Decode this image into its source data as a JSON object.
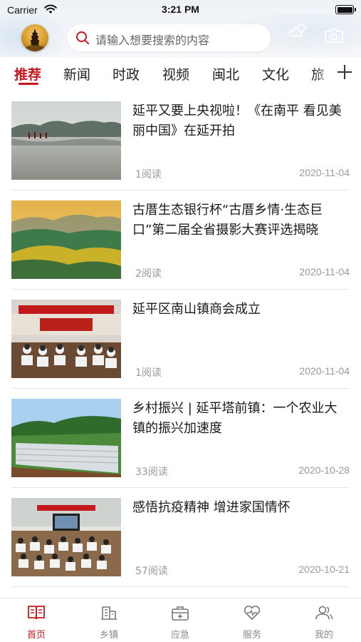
{
  "status_bar": {
    "carrier": "Carrier",
    "time": "3:21 PM"
  },
  "header": {
    "search_placeholder": "请输入想要搜索的内容",
    "weather": {
      "temperature": "26°C",
      "icon": "partly-cloudy-icon"
    },
    "camera_icon": "camera-icon"
  },
  "tabs": [
    {
      "label": "推荐",
      "active": true
    },
    {
      "label": "新闻"
    },
    {
      "label": "时政"
    },
    {
      "label": "视频"
    },
    {
      "label": "闽北"
    },
    {
      "label": "文化"
    },
    {
      "label": "旅"
    }
  ],
  "feed": [
    {
      "title": "延平又要上央视啦！《在南平 看见美丽中国》在延开拍",
      "reads": "1阅读",
      "date": "2020-11-04"
    },
    {
      "title": "古厝生态银行杯“古厝乡情·生态巨口”第二届全省摄影大赛评选揭晓",
      "reads": "2阅读",
      "date": "2020-11-04"
    },
    {
      "title": "延平区南山镇商会成立",
      "reads": "1阅读",
      "date": "2020-11-04"
    },
    {
      "title": "乡村振兴 | 延平塔前镇：一个农业大镇的振兴加速度",
      "reads": "33阅读",
      "date": "2020-10-28"
    },
    {
      "title": "感悟抗疫精神 增进家国情怀",
      "reads": "57阅读",
      "date": "2020-10-21"
    }
  ],
  "tabbar": [
    {
      "label": "首页",
      "icon": "book-icon",
      "active": true
    },
    {
      "label": "乡镇",
      "icon": "building-icon"
    },
    {
      "label": "应急",
      "icon": "first-aid-kit-icon"
    },
    {
      "label": "服务",
      "icon": "heart-pulse-icon"
    },
    {
      "label": "我的",
      "icon": "users-icon"
    }
  ],
  "colors": {
    "accent": "#c8161d",
    "muted_text": "#999999",
    "divider": "#e6e6e6"
  }
}
